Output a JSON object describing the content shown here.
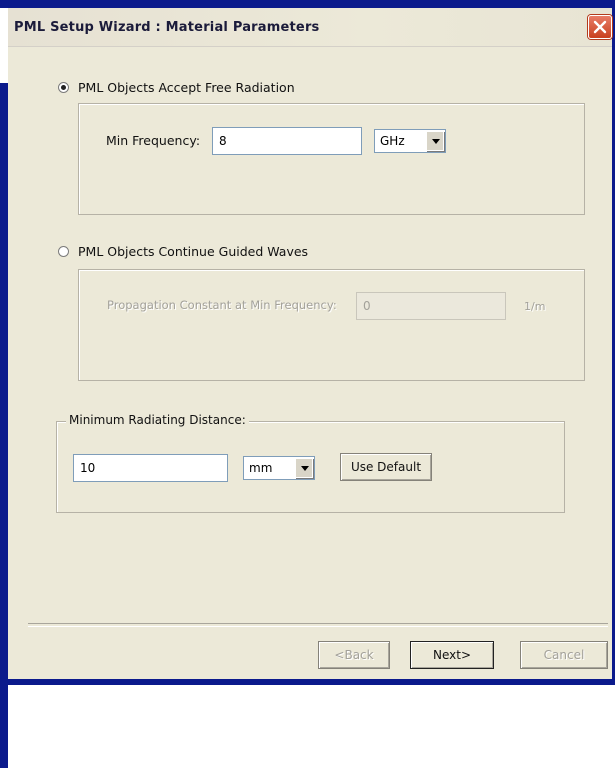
{
  "window": {
    "title": "PML Setup Wizard : Material Parameters"
  },
  "radio_free": {
    "label": "PML Objects Accept Free Radiation",
    "checked": true
  },
  "min_frequency": {
    "label": "Min Frequency:",
    "value": "8",
    "unit": "GHz"
  },
  "radio_guided": {
    "label": "PML Objects Continue Guided Waves",
    "checked": false
  },
  "propagation": {
    "label": "Propagation Constant at Min Frequency:",
    "value": "0",
    "unit": "1/m"
  },
  "min_radiating": {
    "caption": "Minimum Radiating Distance:",
    "value": "10",
    "unit": "mm",
    "default_button": "Use Default"
  },
  "buttons": {
    "back": "<Back",
    "next": "Next>",
    "cancel": "Cancel"
  },
  "colors": {
    "frame": "#0b1a8c",
    "dialog": "#ece9d8",
    "close": "#c9401f"
  }
}
